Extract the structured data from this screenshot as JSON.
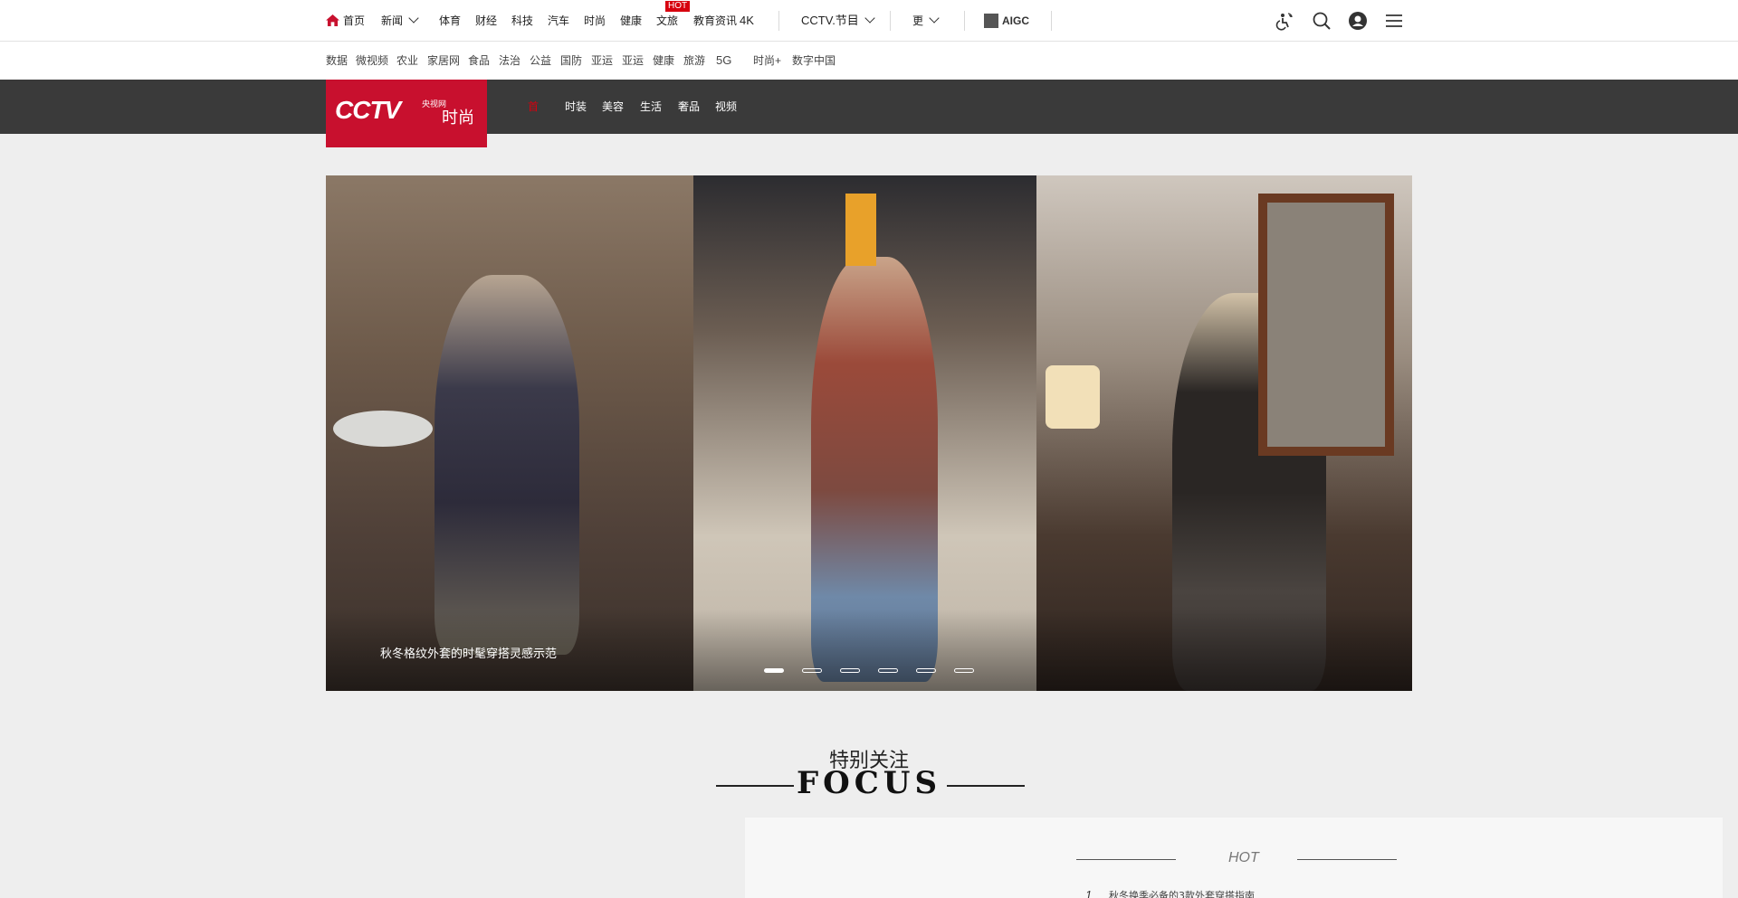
{
  "topnav": {
    "items": [
      {
        "label": "首页",
        "icon": "home-icon"
      },
      {
        "label": "新闻",
        "dropdown": true
      },
      {
        "label": "体育"
      },
      {
        "label": "财经"
      },
      {
        "label": "科技"
      },
      {
        "label": "汽车"
      },
      {
        "label": "时尚"
      },
      {
        "label": "健康"
      },
      {
        "label": "文旅",
        "badge": "HOT"
      },
      {
        "label": "教育资讯"
      },
      {
        "label": "4K"
      }
    ],
    "cctv_label": "CCTV.节目",
    "more_label": "更",
    "aigc_label": "AIGC"
  },
  "subnav": {
    "items": [
      "数据",
      "微视频",
      "农业",
      "家居网",
      "食品",
      "法治",
      "公益",
      "国防",
      "亚运",
      "亚运",
      "健康",
      "旅游",
      "5G",
      "时尚+",
      "数字中国"
    ]
  },
  "channels": {
    "items": [
      "首",
      "时装",
      "美容",
      "生活",
      "奢品",
      "视频"
    ],
    "active_index": 0
  },
  "logo": {
    "mark": "CCTV",
    "sub": "央视网",
    "name": "时尚"
  },
  "carousel": {
    "caption": "秋冬格纹外套的时髦穿搭灵感示范",
    "slides": 6,
    "active": 0
  },
  "focus": {
    "title_cn": "特别关注",
    "title_en": "FOCUS"
  },
  "hot": {
    "title": "HOT",
    "items": [
      {
        "index": "1",
        "text": "秋冬换季必备的3款外套穿搭指南"
      }
    ]
  },
  "colors": {
    "brand_red": "#c8102e",
    "channel_bar": "#3a3a3a",
    "active_red": "#d7000f"
  }
}
